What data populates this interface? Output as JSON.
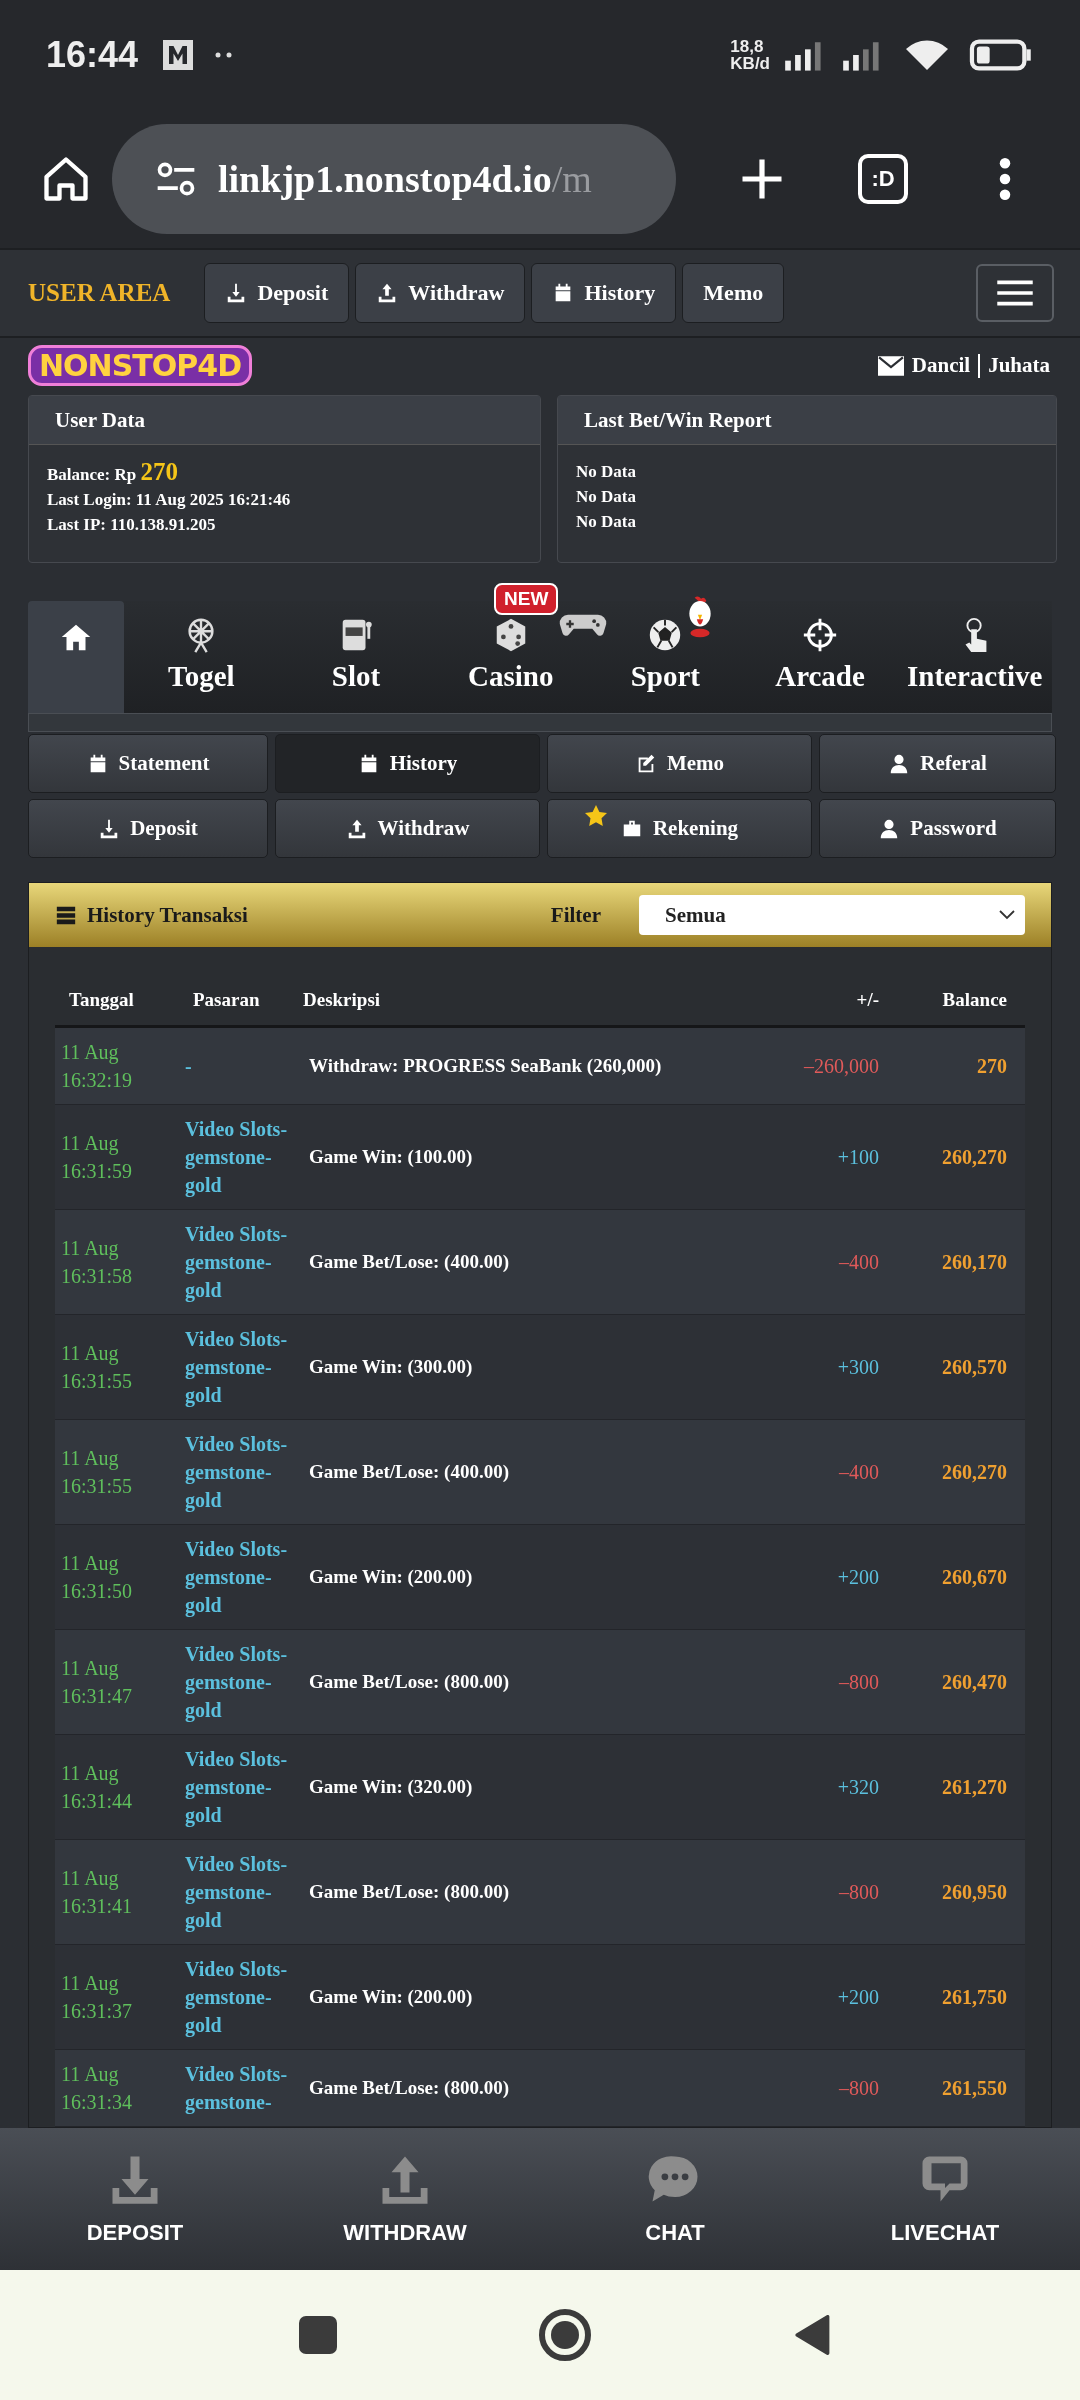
{
  "status_bar": {
    "time": "16:44",
    "speed_value": "18,8",
    "speed_unit": "KB/d"
  },
  "browser": {
    "url_host": "linkjp1.nonstop4d.io",
    "url_path": "/m",
    "tabs_label": ":D"
  },
  "user_area": {
    "title": "USER AREA",
    "buttons": [
      {
        "label": "Deposit",
        "kind": "deposit"
      },
      {
        "label": "Withdraw",
        "kind": "withdraw"
      },
      {
        "label": "History",
        "kind": "calendar"
      },
      {
        "label": "Memo",
        "kind": "none"
      }
    ]
  },
  "logo": "NONSTOP4D",
  "user_links": [
    "Dancil",
    "Juhata"
  ],
  "user_data": {
    "title": "User Data",
    "balance_label": "Balance: Rp",
    "balance_value": "270",
    "lines": [
      "Last Login: 11 Aug 2025 16:21:46",
      "Last IP: 110.138.91.205"
    ]
  },
  "report": {
    "title": "Last Bet/Win Report",
    "lines": [
      "No Data",
      "No Data",
      "No Data"
    ]
  },
  "game_tabs": [
    {
      "kind": "home",
      "selected": true
    },
    {
      "label": "Togel",
      "kind": "wheel",
      "selected": false
    },
    {
      "label": "Slot",
      "kind": "slot",
      "selected": false
    },
    {
      "label": "Casino",
      "kind": "dice",
      "selected": false
    },
    {
      "label": "Sport",
      "kind": "ball",
      "selected": false
    },
    {
      "label": "Arcade",
      "kind": "target",
      "selected": false
    },
    {
      "label": "Interactive",
      "kind": "hand",
      "selected": false
    }
  ],
  "new_badge": "NEW",
  "account_menu": [
    {
      "label": "Statement",
      "kind": "calendar",
      "selected": false,
      "starred": false
    },
    {
      "label": "History",
      "kind": "calendar",
      "selected": true,
      "starred": false
    },
    {
      "label": "Memo",
      "kind": "memo",
      "selected": false,
      "starred": false
    },
    {
      "label": "Referal",
      "kind": "user",
      "selected": false,
      "starred": false
    },
    {
      "label": "Deposit",
      "kind": "deposit",
      "selected": false,
      "starred": false
    },
    {
      "label": "Withdraw",
      "kind": "withdraw",
      "selected": false,
      "starred": false
    },
    {
      "label": "Rekening",
      "kind": "briefcase",
      "selected": false,
      "starred": true
    },
    {
      "label": "Password",
      "kind": "user",
      "selected": false,
      "starred": false
    }
  ],
  "history": {
    "title": "History Transaksi",
    "filter_label": "Filter",
    "filter_value": "Semua",
    "columns": [
      "Tanggal",
      "Pasaran",
      "Deskripsi",
      "+/-",
      "Balance"
    ],
    "rows": [
      {
        "date": "11 Aug",
        "time": "16:32:19",
        "market": "-",
        "description": "Withdraw: PROGRESS SeaBank (260,000)",
        "amount": "–260,000",
        "kind": "debit",
        "balance": "270"
      },
      {
        "date": "11 Aug",
        "time": "16:31:59",
        "market": "Video Slots-gemstone-gold",
        "description": "Game Win: (100.00)",
        "amount": "+100",
        "kind": "credit",
        "balance": "260,270"
      },
      {
        "date": "11 Aug",
        "time": "16:31:58",
        "market": "Video Slots-gemstone-gold",
        "description": "Game Bet/Lose: (400.00)",
        "amount": "–400",
        "kind": "debit",
        "balance": "260,170"
      },
      {
        "date": "11 Aug",
        "time": "16:31:55",
        "market": "Video Slots-gemstone-gold",
        "description": "Game Win: (300.00)",
        "amount": "+300",
        "kind": "credit",
        "balance": "260,570"
      },
      {
        "date": "11 Aug",
        "time": "16:31:55",
        "market": "Video Slots-gemstone-gold",
        "description": "Game Bet/Lose: (400.00)",
        "amount": "–400",
        "kind": "debit",
        "balance": "260,270"
      },
      {
        "date": "11 Aug",
        "time": "16:31:50",
        "market": "Video Slots-gemstone-gold",
        "description": "Game Win: (200.00)",
        "amount": "+200",
        "kind": "credit",
        "balance": "260,670"
      },
      {
        "date": "11 Aug",
        "time": "16:31:47",
        "market": "Video Slots-gemstone-gold",
        "description": "Game Bet/Lose: (800.00)",
        "amount": "–800",
        "kind": "debit",
        "balance": "260,470"
      },
      {
        "date": "11 Aug",
        "time": "16:31:44",
        "market": "Video Slots-gemstone-gold",
        "description": "Game Win: (320.00)",
        "amount": "+320",
        "kind": "credit",
        "balance": "261,270"
      },
      {
        "date": "11 Aug",
        "time": "16:31:41",
        "market": "Video Slots-gemstone-gold",
        "description": "Game Bet/Lose: (800.00)",
        "amount": "–800",
        "kind": "debit",
        "balance": "260,950"
      },
      {
        "date": "11 Aug",
        "time": "16:31:37",
        "market": "Video Slots-gemstone-gold",
        "description": "Game Win: (200.00)",
        "amount": "+200",
        "kind": "credit",
        "balance": "261,750"
      },
      {
        "date": "11 Aug",
        "time": "16:31:34",
        "market": "Video Slots-gemstone-",
        "description": "Game Bet/Lose: (800.00)",
        "amount": "–800",
        "kind": "debit",
        "balance": "261,550"
      }
    ]
  },
  "bottom_nav": [
    {
      "label": "DEPOSIT",
      "kind": "download"
    },
    {
      "label": "WITHDRAW",
      "kind": "upload"
    },
    {
      "label": "CHAT",
      "kind": "chat"
    },
    {
      "label": "LIVECHAT",
      "kind": "livechat"
    }
  ]
}
